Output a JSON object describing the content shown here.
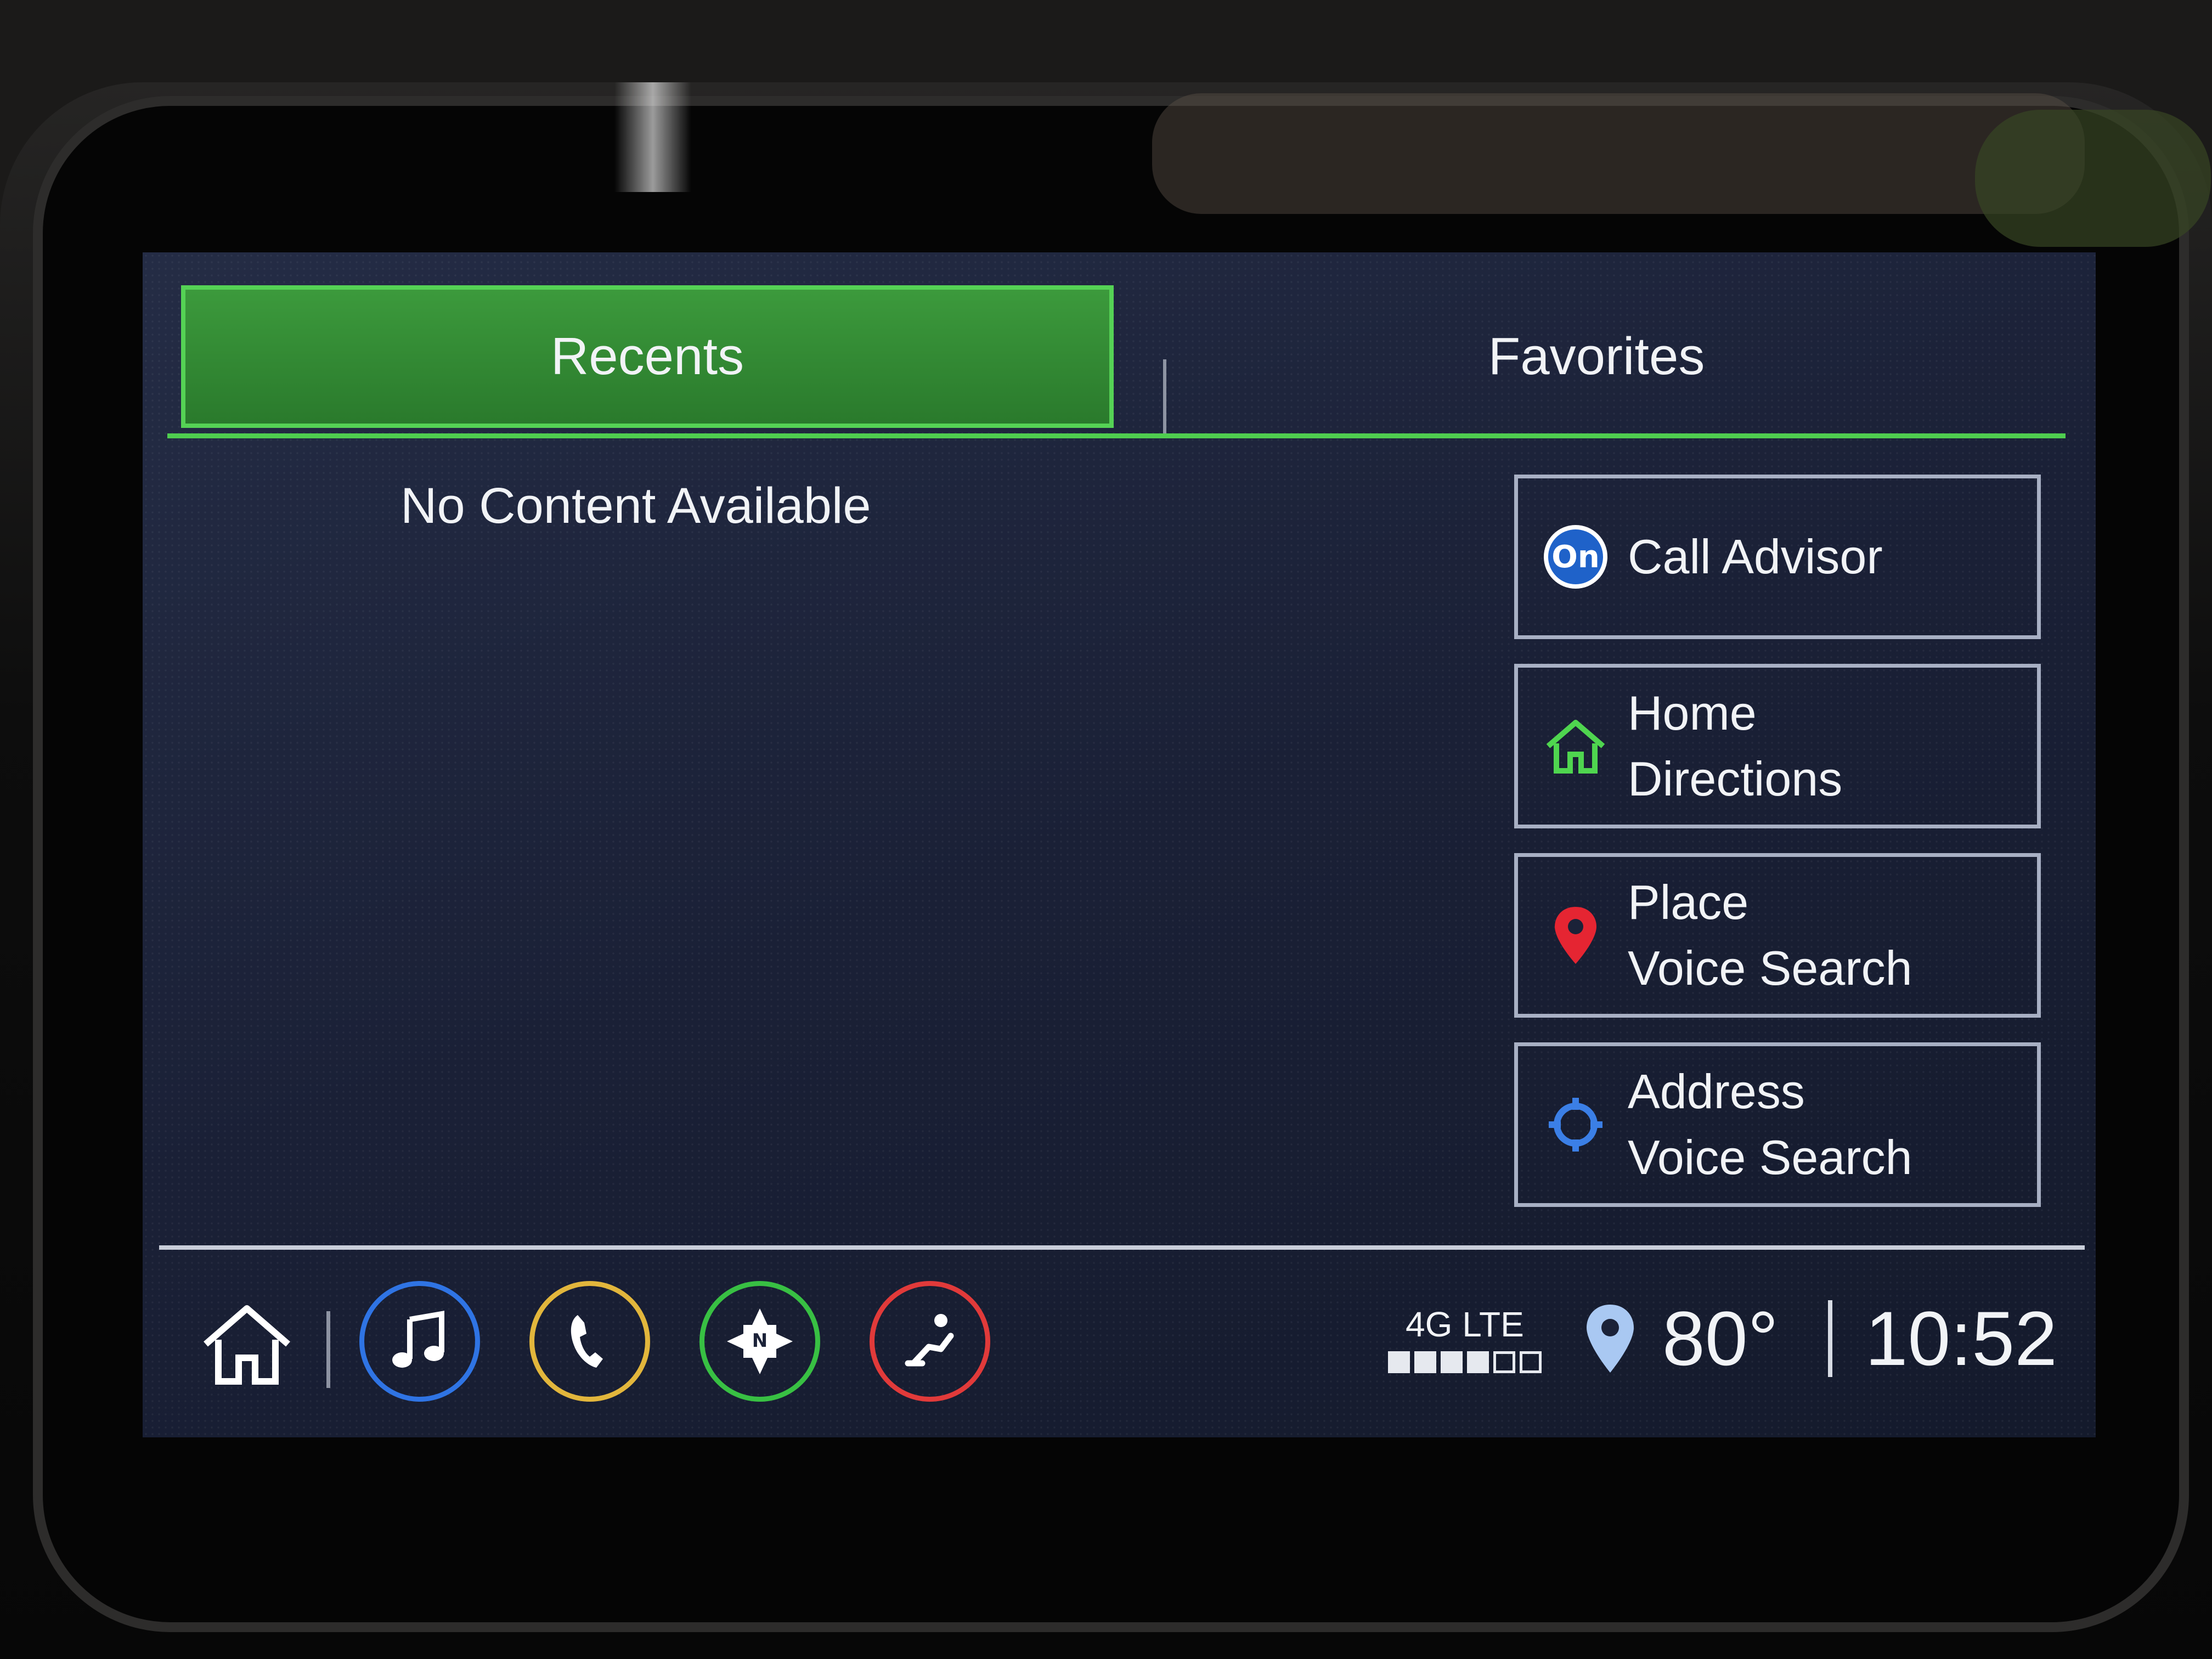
{
  "tabs": {
    "recents": "Recents",
    "favorites": "Favorites"
  },
  "main": {
    "empty_message": "No Content Available"
  },
  "shortcuts": [
    {
      "label_line1": "Call Advisor",
      "label_line2": "",
      "icon": "onstar-icon"
    },
    {
      "label_line1": "Home",
      "label_line2": "Directions",
      "icon": "home-icon"
    },
    {
      "label_line1": "Place",
      "label_line2": "Voice Search",
      "icon": "map-pin-icon"
    },
    {
      "label_line1": "Address",
      "label_line2": "Voice Search",
      "icon": "crosshair-icon"
    }
  ],
  "status": {
    "network": "4G LTE",
    "signal_bars": 4,
    "signal_max": 6,
    "temperature": "80°",
    "time": "10:52"
  },
  "colors": {
    "active_tab": "#2e8a30",
    "accent_green": "#4fcd4f",
    "audio_ring": "#2f74e4",
    "phone_ring": "#e2b63c",
    "nav_ring": "#38c043",
    "climate_ring": "#e13a3a"
  }
}
